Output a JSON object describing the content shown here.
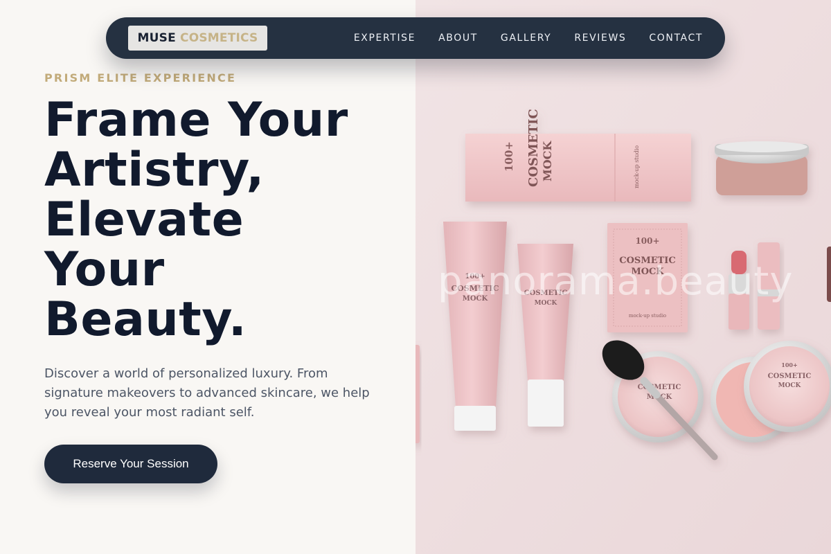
{
  "nav": {
    "logo_primary": "MUSE",
    "logo_secondary": "COSMETICS",
    "links": [
      "EXPERTISE",
      "ABOUT",
      "GALLERY",
      "REVIEWS",
      "CONTACT"
    ]
  },
  "hero": {
    "eyebrow": "PRISM ELITE EXPERIENCE",
    "headline_lines": [
      "Frame Your",
      "Artistry,",
      "Elevate",
      "Your",
      "Beauty."
    ],
    "lead": "Discover a world of personalized luxury. From signature makeovers to advanced skincare, we help you reveal your most radiant self.",
    "cta_label": "Reserve Your Session"
  },
  "image": {
    "watermark": "panorama.beauty",
    "product_text": {
      "brand_number": "100+",
      "brand_name": "COSMETIC",
      "brand_sub": "MOCK",
      "studio": "mock-up studio"
    }
  },
  "colors": {
    "nav_bg": "#253141",
    "accent_gold": "#c2ab7a",
    "headline": "#111a2d",
    "cta_bg": "#1f2a3c",
    "photo_bg": "#eedfe1",
    "product_pink": "#e8b9bb"
  }
}
